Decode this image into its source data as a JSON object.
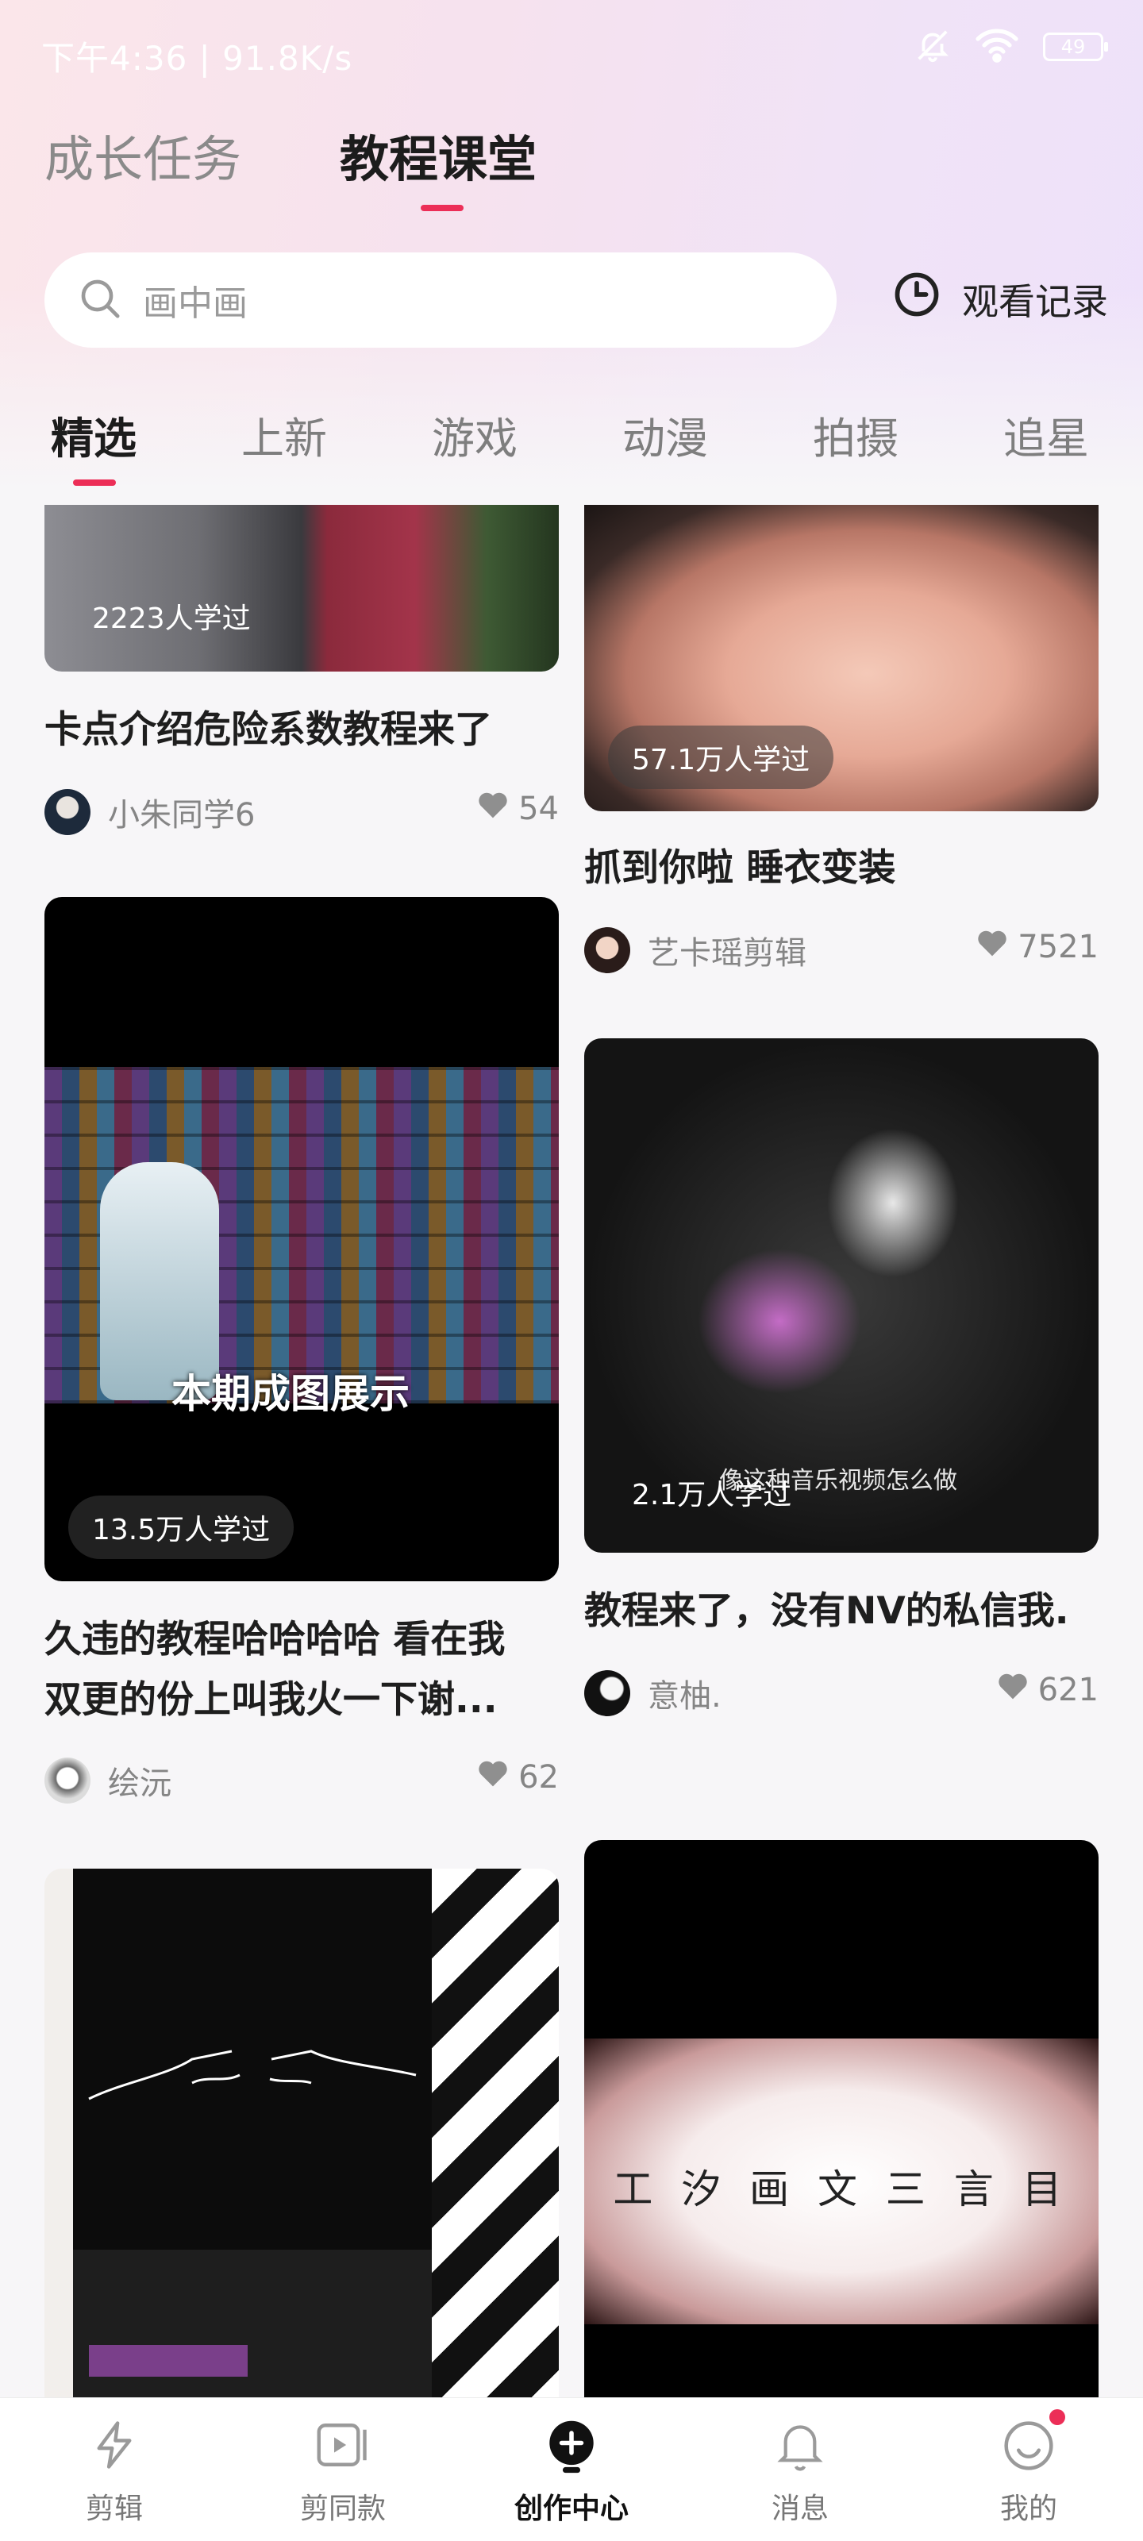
{
  "status_bar": {
    "time": "下午4:36 | 91.8K/s",
    "battery": "49"
  },
  "top_tabs": [
    {
      "label": "成长任务",
      "active": false
    },
    {
      "label": "教程课堂",
      "active": true
    }
  ],
  "search": {
    "placeholder": "画中画",
    "history_label": "观看记录"
  },
  "categories": [
    {
      "label": "精选",
      "active": true
    },
    {
      "label": "上新",
      "active": false
    },
    {
      "label": "游戏",
      "active": false
    },
    {
      "label": "动漫",
      "active": false
    },
    {
      "label": "拍摄",
      "active": false
    },
    {
      "label": "追星",
      "active": false
    }
  ],
  "cards": [
    {
      "learners": "2223人学过",
      "title": "卡点介绍危险系数教程来了",
      "author": "小朱同学6",
      "likes": "54"
    },
    {
      "learners": "57.1万人学过",
      "title": "抓到你啦 睡衣变装",
      "author": "艺卡瑶剪辑",
      "likes": "7521"
    },
    {
      "learners": "13.5万人学过",
      "overlay": "本期成图展示",
      "title_line1": "久违的教程哈哈哈哈 看在我",
      "title_line2": "双更的份上叫我火一下谢...",
      "author": "绘沅",
      "likes": "62"
    },
    {
      "learners": "2.1万人学过",
      "overlay": "像这种音乐视频怎么做",
      "title": "教程来了，没有NV的私信我.",
      "author": "意柚.",
      "likes": "621"
    },
    {
      "caption": "工 汐 画 文 三 言 目"
    }
  ],
  "bottom_nav": [
    {
      "label": "剪辑",
      "icon": "lightning-icon",
      "active": false
    },
    {
      "label": "剪同款",
      "icon": "video-play-icon",
      "active": false
    },
    {
      "label": "创作中心",
      "icon": "bulb-icon",
      "active": true
    },
    {
      "label": "消息",
      "icon": "bell-icon",
      "active": false
    },
    {
      "label": "我的",
      "icon": "smile-icon",
      "active": false,
      "dot": true
    }
  ],
  "colors": {
    "accent": "#ec2e57",
    "background": "#f7f6f8"
  }
}
